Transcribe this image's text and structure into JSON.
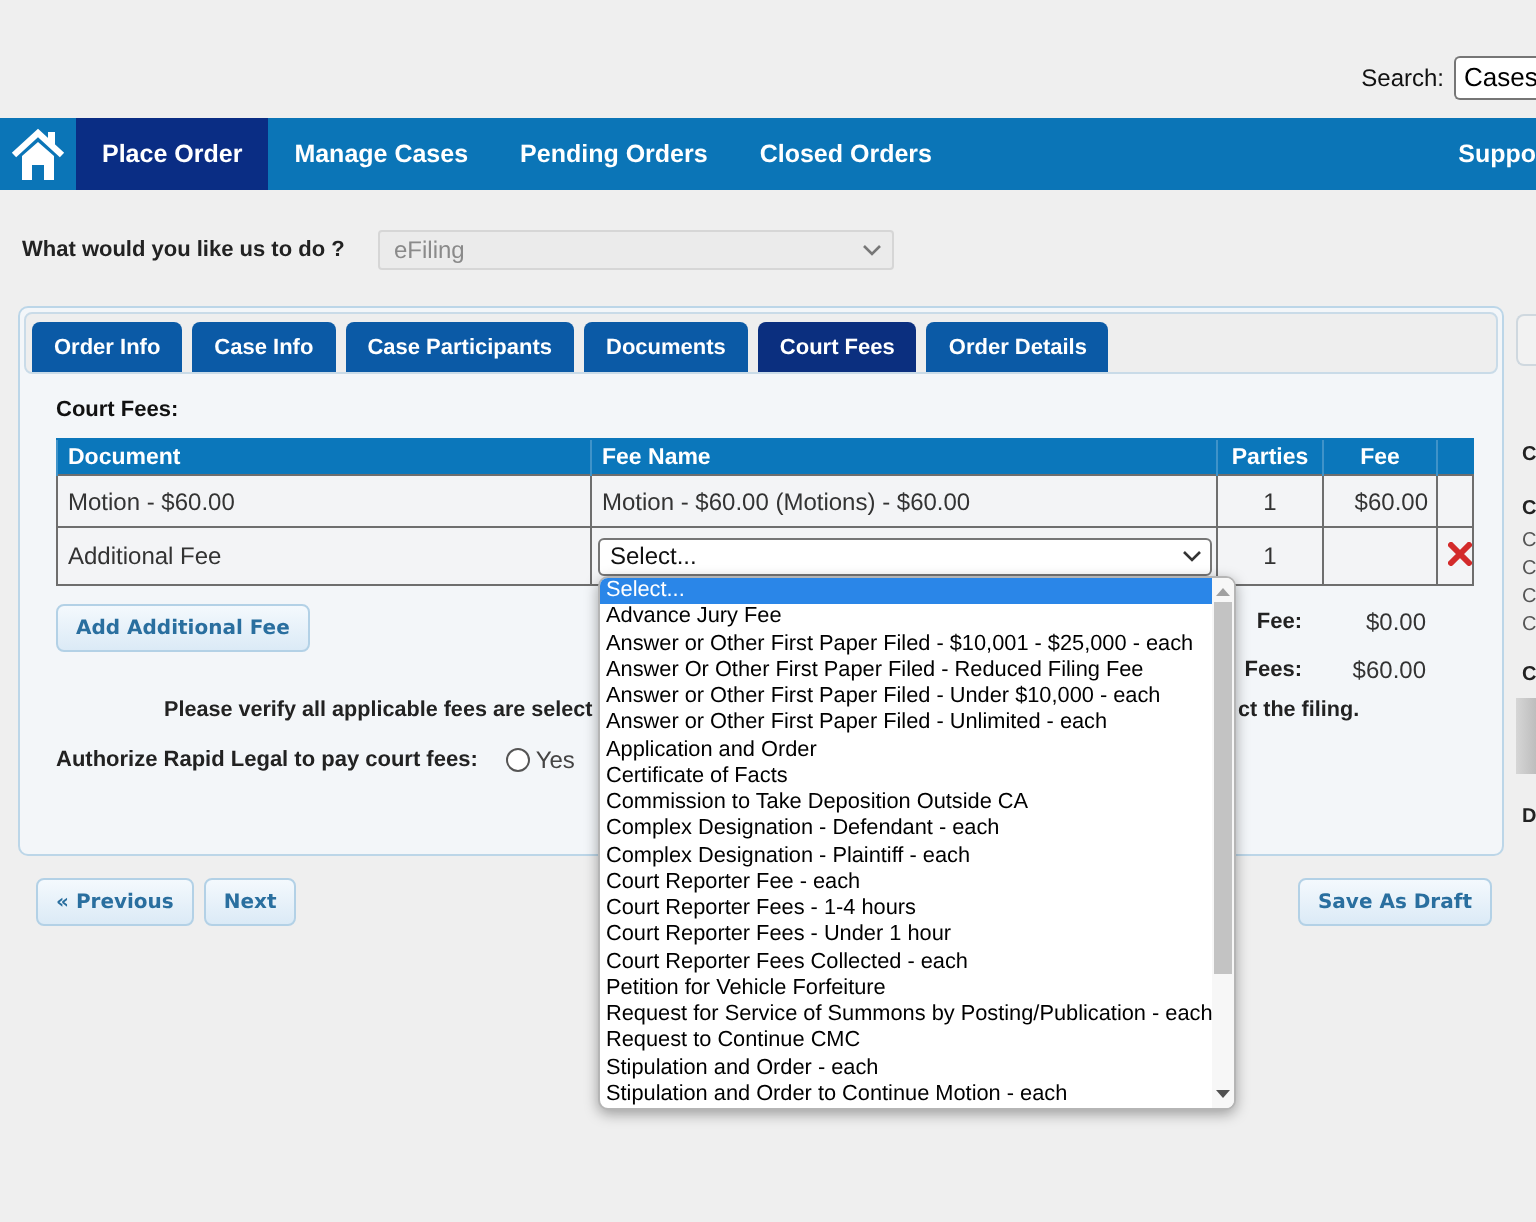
{
  "header": {
    "search_label": "Search:",
    "search_value": "Cases"
  },
  "nav": {
    "items": [
      {
        "label": "Place Order",
        "selected": true
      },
      {
        "label": "Manage Cases",
        "selected": false
      },
      {
        "label": "Pending Orders",
        "selected": false
      },
      {
        "label": "Closed Orders",
        "selected": false
      }
    ],
    "right_items": [
      {
        "label": "Suppo",
        "selected": false
      }
    ]
  },
  "task": {
    "label": "What would you like us to do ?",
    "value": "eFiling",
    "disabled": true
  },
  "tabs": [
    {
      "label": "Order Info",
      "selected": false
    },
    {
      "label": "Case Info",
      "selected": false
    },
    {
      "label": "Case Participants",
      "selected": false
    },
    {
      "label": "Documents",
      "selected": false
    },
    {
      "label": "Court Fees",
      "selected": true
    },
    {
      "label": "Order Details",
      "selected": false
    }
  ],
  "court_fees": {
    "title": "Court Fees:",
    "table": {
      "columns": [
        "Document",
        "Fee Name",
        "Parties",
        "Fee"
      ],
      "rows": [
        {
          "document": "Motion - $60.00",
          "fee_name": {
            "kind": "text",
            "value": "Motion - $60.00 (Motions) - $60.00"
          },
          "parties": "1",
          "fee": "$60.00",
          "removable": false
        },
        {
          "document": "Additional Fee",
          "fee_name": {
            "kind": "select",
            "value": "Select...",
            "open": true,
            "options": [
              {
                "label": "Select...",
                "selected": true
              },
              {
                "label": "Advance Jury Fee",
                "selected": false
              },
              {
                "label": "Answer or Other First Paper Filed - $10,001 - $25,000 - each",
                "selected": false
              },
              {
                "label": "Answer Or Other First Paper Filed - Reduced Filing Fee",
                "selected": false
              },
              {
                "label": "Answer or Other First Paper Filed - Under $10,000 - each",
                "selected": false
              },
              {
                "label": "Answer or Other First Paper Filed - Unlimited - each",
                "selected": false
              },
              {
                "label": "Application and Order",
                "selected": false
              },
              {
                "label": "Certificate of Facts",
                "selected": false
              },
              {
                "label": "Commission to Take Deposition Outside CA",
                "selected": false
              },
              {
                "label": "Complex Designation - Defendant - each",
                "selected": false
              },
              {
                "label": "Complex Designation - Plaintiff - each",
                "selected": false
              },
              {
                "label": "Court Reporter Fee - each",
                "selected": false
              },
              {
                "label": "Court Reporter Fees - 1-4 hours",
                "selected": false
              },
              {
                "label": "Court Reporter Fees - Under 1 hour",
                "selected": false
              },
              {
                "label": "Court Reporter Fees Collected - each",
                "selected": false
              },
              {
                "label": "Petition for Vehicle Forfeiture",
                "selected": false
              },
              {
                "label": "Request for Service of Summons by Posting/Publication - each",
                "selected": false
              },
              {
                "label": "Request to Continue CMC",
                "selected": false
              },
              {
                "label": "Stipulation and Order - each",
                "selected": false
              },
              {
                "label": "Stipulation and Order to Continue Motion - each",
                "selected": false
              }
            ]
          },
          "parties": "1",
          "removable": true
        }
      ]
    },
    "add_button": "Add Additional Fee",
    "totals": [
      {
        "label": "Fee:",
        "value": "$0.00"
      },
      {
        "label": "Fees:",
        "value": "$60.00"
      }
    ],
    "notice": [
      "Please verify all applicable fees are select",
      "ct the filing."
    ],
    "authorize": {
      "label": "Authorize Rapid Legal to pay court fees:",
      "options": [
        {
          "label": "Yes",
          "selected": false
        }
      ]
    }
  },
  "footer_buttons": {
    "previous": "« Previous",
    "next": "Next",
    "save": "Save As Draft"
  },
  "side_panel": {
    "lines": [
      {
        "kind": "heading",
        "text": "C"
      },
      {
        "kind": "heading",
        "text": "C"
      },
      {
        "kind": "line",
        "text": "C"
      },
      {
        "kind": "line",
        "text": "C"
      },
      {
        "kind": "line",
        "text": "C"
      },
      {
        "kind": "line",
        "text": "C"
      },
      {
        "kind": "heading",
        "text": "C"
      },
      {
        "kind": "blurred"
      },
      {
        "kind": "heading",
        "text": "D"
      }
    ]
  }
}
